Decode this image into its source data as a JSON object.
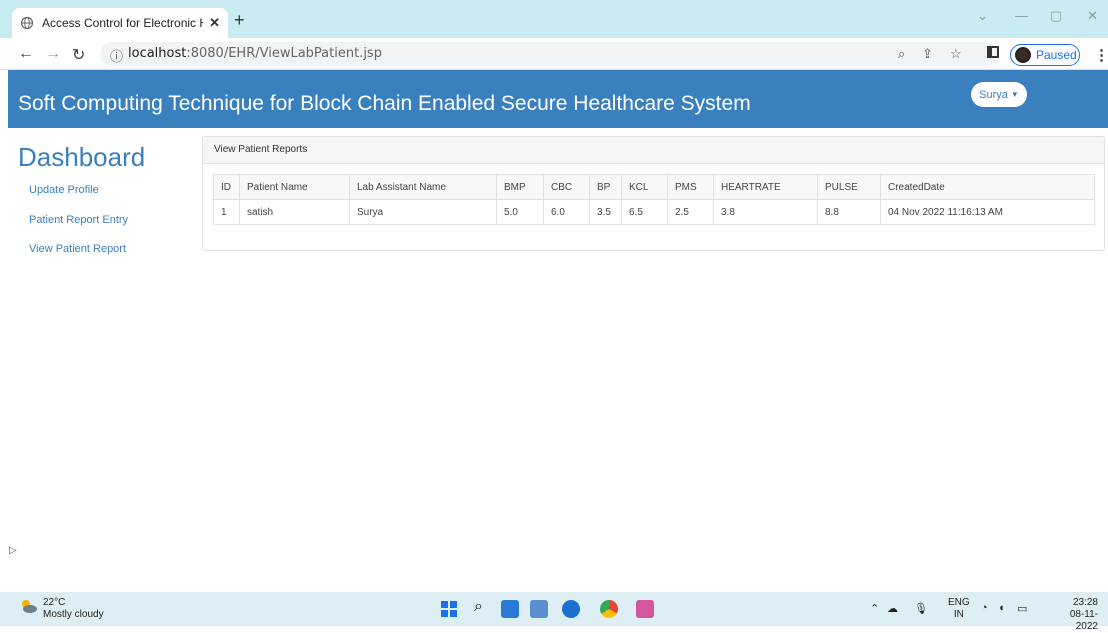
{
  "browser": {
    "tab_title": "Access Control for Electronic Hea",
    "tab_close": "✕",
    "new_tab": "+",
    "url_host": "localhost",
    "url_rest": ":8080/EHR/ViewLabPatient.jsp",
    "profile_status": "Paused"
  },
  "header": {
    "title": "Soft Computing Technique for Block Chain Enabled Secure Healthcare System",
    "user_label": "Surya"
  },
  "sidebar": {
    "heading": "Dashboard",
    "items": [
      {
        "label": "Update Profile"
      },
      {
        "label": "Patient Report Entry"
      },
      {
        "label": "View Patient Report"
      }
    ]
  },
  "panel": {
    "title": "View Patient Reports",
    "columns": [
      "ID",
      "Patient Name",
      "Lab Assistant Name",
      "BMP",
      "CBC",
      "BP",
      "KCL",
      "PMS",
      "HEARTRATE",
      "PULSE",
      "CreatedDate"
    ],
    "rows": [
      [
        "1",
        "satish",
        "Surya",
        "5.0",
        "6.0",
        "3.5",
        "6.5",
        "2.5",
        "3.8",
        "8.8",
        "04 Nov 2022 11:16:13 AM"
      ]
    ]
  },
  "taskbar": {
    "temperature": "22°C",
    "weather": "Mostly cloudy",
    "lang_top": "ENG",
    "lang_bottom": "IN",
    "time": "23:28",
    "date": "08-11-2022"
  },
  "colors": {
    "accent": "#3a80bf",
    "tab_strip": "#c9ecf3",
    "taskbar": "#ddeef5"
  }
}
